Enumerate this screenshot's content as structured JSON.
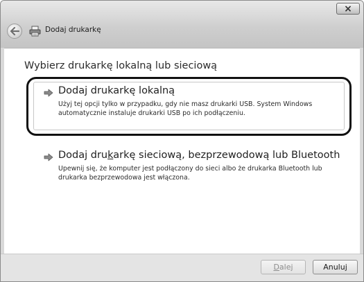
{
  "window": {
    "title": "Dodaj drukarkę",
    "close_glyph": "×",
    "colors": {
      "chrome": "#d9d9d9",
      "content_bg": "#ffffff",
      "highlight_frame": "#111111"
    }
  },
  "navigation": {
    "back_icon": "back-arrow-icon",
    "title_icon": "printer-icon"
  },
  "main": {
    "heading": "Wybierz drukarkę lokalną lub sieciową",
    "options": [
      {
        "icon": "green-arrow-icon",
        "title_pre": "Dodaj drukarkę lokalną",
        "title_accel": "",
        "title_post": "",
        "description_line1": "Użyj tej opcji tylko w przypadku, gdy nie masz drukarki USB. System Windows",
        "description_line2": "automatycznie instaluje drukarki USB po ich podłączeniu.",
        "highlighted": true
      },
      {
        "icon": "green-arrow-icon",
        "title_pre": "Dodaj dru",
        "title_accel": "k",
        "title_post": "arkę sieciową, bezprzewodową lub Bluetooth",
        "description_line1": "Upewnij się, że komputer jest podłączony do sieci albo że drukarka Bluetooth lub",
        "description_line2": "drukarka bezprzewodowa jest włączona.",
        "highlighted": false
      }
    ]
  },
  "footer": {
    "next_accel": "D",
    "next_rest": "alej",
    "next_enabled": false,
    "cancel_label": "Anuluj"
  }
}
